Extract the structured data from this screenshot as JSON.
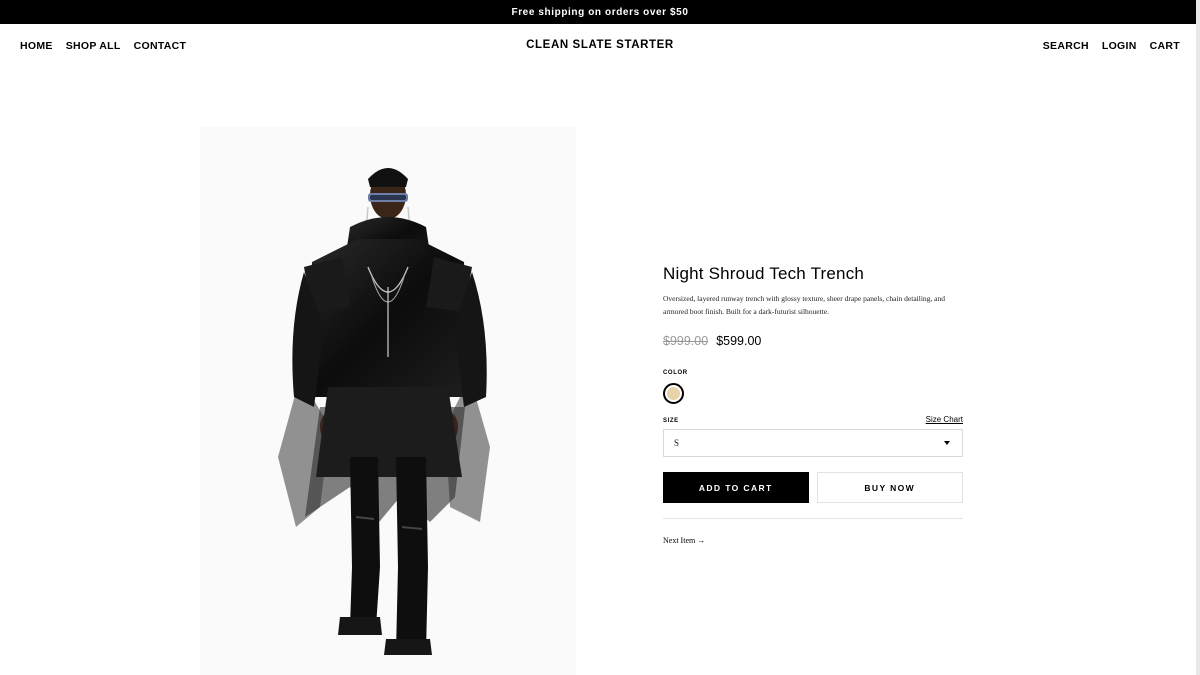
{
  "announcement": "Free shipping on orders over $50",
  "nav": {
    "left": [
      "HOME",
      "SHOP ALL",
      "CONTACT"
    ],
    "brand": "CLEAN SLATE STARTER",
    "right": [
      "SEARCH",
      "LOGIN",
      "CART"
    ]
  },
  "product": {
    "title": "Night Shroud Tech Trench",
    "description": "Oversized, layered runway trench with glossy texture, sheer drape panels, chain detailing, and armored boot finish. Built for a dark-futurist silhouette.",
    "price_original": "$999.00",
    "price_sale": "$599.00",
    "color_label": "COLOR",
    "swatch_color": "#e8d3a8",
    "size_label": "SIZE",
    "size_chart": "Size Chart",
    "size_selected": "S",
    "add_to_cart": "ADD TO CART",
    "buy_now": "BUY NOW",
    "next_item": "Next Item →"
  },
  "image": {
    "subject": "model-in-black-leather-trench",
    "accent": "#000000"
  }
}
